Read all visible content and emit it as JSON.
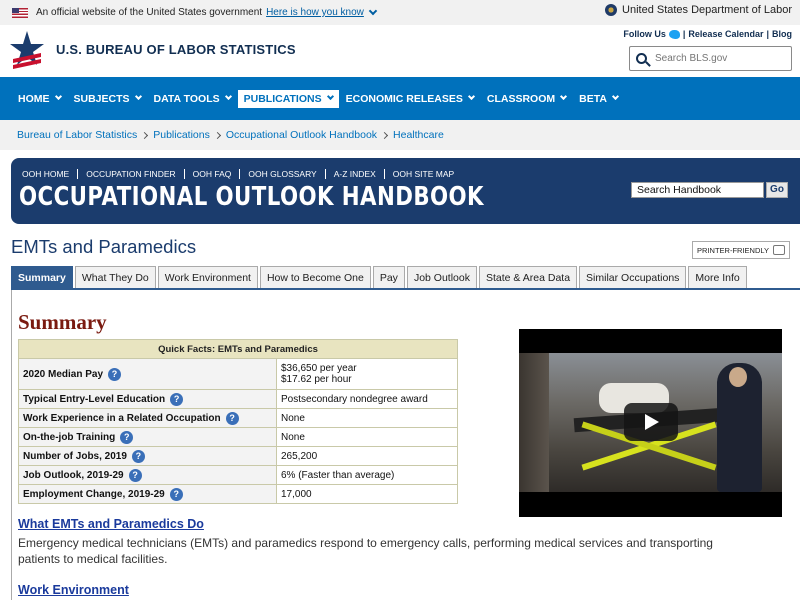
{
  "gov_banner": {
    "text": "An official website of the United States government",
    "link": "Here is how you know"
  },
  "dol": "United States Department of Labor",
  "site_title": "U.S. BUREAU OF LABOR STATISTICS",
  "follow": {
    "label": "Follow Us",
    "release": "Release Calendar",
    "blog": "Blog"
  },
  "search": {
    "placeholder": "Search BLS.gov"
  },
  "nav": [
    {
      "label": "HOME",
      "active": false
    },
    {
      "label": "SUBJECTS",
      "active": false
    },
    {
      "label": "DATA TOOLS",
      "active": false
    },
    {
      "label": "PUBLICATIONS",
      "active": true
    },
    {
      "label": "ECONOMIC RELEASES",
      "active": false
    },
    {
      "label": "CLASSROOM",
      "active": false
    },
    {
      "label": "BETA",
      "active": false
    }
  ],
  "breadcrumb": [
    "Bureau of Labor Statistics",
    "Publications",
    "Occupational Outlook Handbook",
    "Healthcare"
  ],
  "ooh": {
    "links": [
      "OOH HOME",
      "OCCUPATION FINDER",
      "OOH FAQ",
      "OOH GLOSSARY",
      "A-Z INDEX",
      "OOH SITE MAP"
    ],
    "title": "OCCUPATIONAL OUTLOOK HANDBOOK",
    "search_value": "Search Handbook",
    "go": "Go"
  },
  "page_title": "EMTs and Paramedics",
  "printer": "PRINTER-FRIENDLY",
  "tabs": [
    "Summary",
    "What They Do",
    "Work Environment",
    "How to Become One",
    "Pay",
    "Job Outlook",
    "State & Area Data",
    "Similar Occupations",
    "More Info"
  ],
  "summary_heading": "Summary",
  "quick_facts": {
    "header": "Quick Facts: EMTs and Paramedics",
    "rows": [
      {
        "key": "2020 Median Pay",
        "value": "$36,650 per year",
        "value2": "$17.62 per hour"
      },
      {
        "key": "Typical Entry-Level Education",
        "value": "Postsecondary nondegree award"
      },
      {
        "key": "Work Experience in a Related Occupation",
        "value": "None"
      },
      {
        "key": "On-the-job Training",
        "value": "None"
      },
      {
        "key": "Number of Jobs, 2019",
        "value": "265,200"
      },
      {
        "key": "Job Outlook, 2019-29",
        "value": "6% (Faster than average)"
      },
      {
        "key": "Employment Change, 2019-29",
        "value": "17,000"
      }
    ]
  },
  "sections": [
    {
      "title": "What EMTs and Paramedics Do",
      "text": "Emergency medical technicians (EMTs) and paramedics respond to emergency calls, performing medical services and transporting patients to medical facilities."
    },
    {
      "title": "Work Environment",
      "text": ""
    }
  ]
}
